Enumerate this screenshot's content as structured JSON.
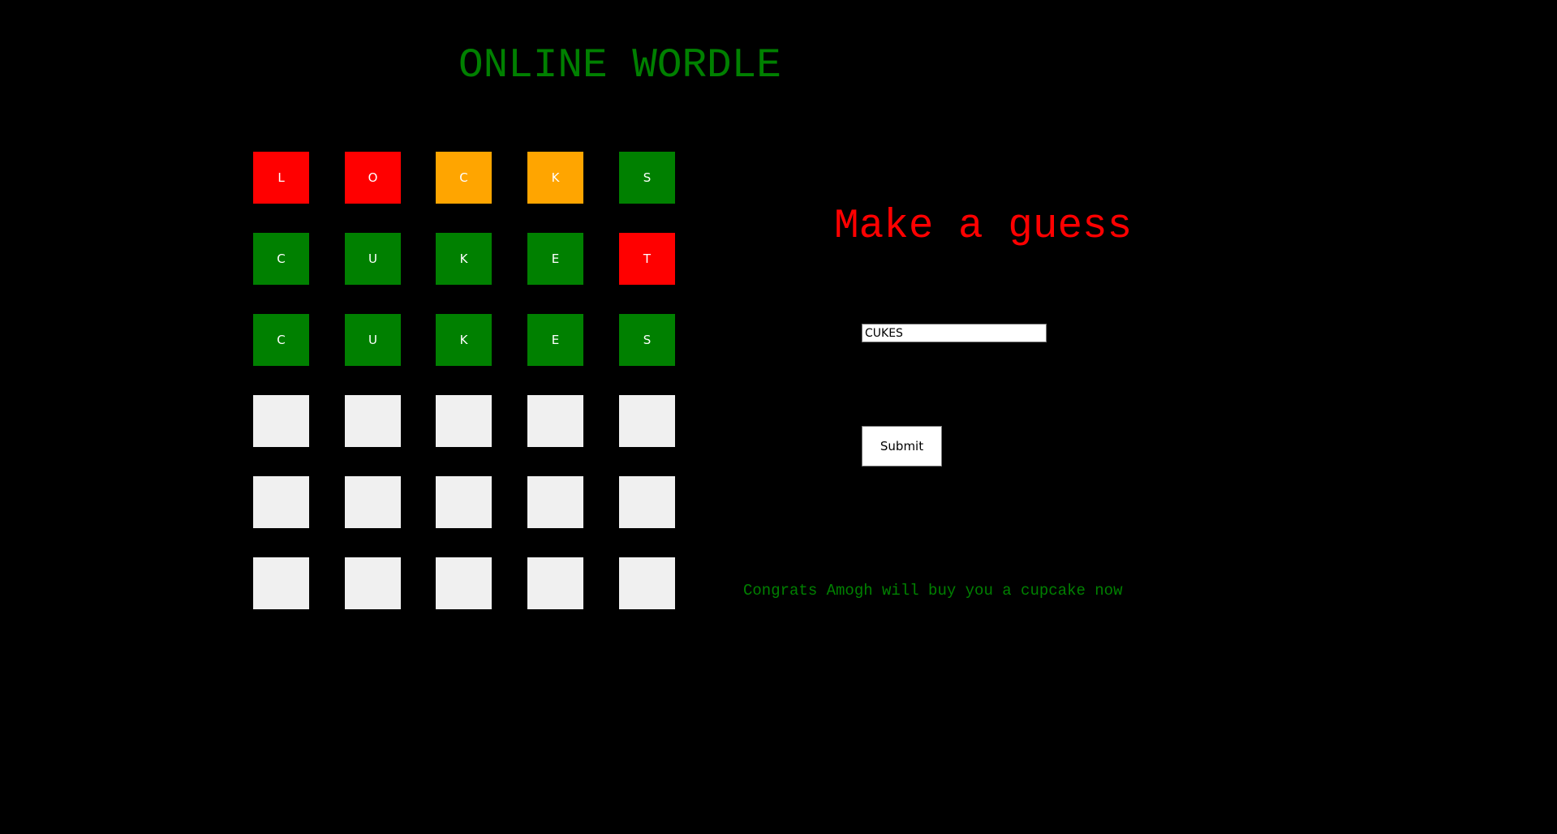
{
  "header": {
    "title": "ONLINE WORDLE"
  },
  "colors": {
    "background": "#000000",
    "title": "#008000",
    "prompt": "#ff0000",
    "message": "#008000",
    "tile_text": "#ffffff",
    "status": {
      "absent": "#ff0000",
      "present": "#ffa500",
      "correct": "#008000",
      "empty": "#f0f0f0"
    }
  },
  "board": {
    "rows": [
      [
        {
          "letter": "L",
          "status": "absent"
        },
        {
          "letter": "O",
          "status": "absent"
        },
        {
          "letter": "C",
          "status": "present"
        },
        {
          "letter": "K",
          "status": "present"
        },
        {
          "letter": "S",
          "status": "correct"
        }
      ],
      [
        {
          "letter": "C",
          "status": "correct"
        },
        {
          "letter": "U",
          "status": "correct"
        },
        {
          "letter": "K",
          "status": "correct"
        },
        {
          "letter": "E",
          "status": "correct"
        },
        {
          "letter": "T",
          "status": "absent"
        }
      ],
      [
        {
          "letter": "C",
          "status": "correct"
        },
        {
          "letter": "U",
          "status": "correct"
        },
        {
          "letter": "K",
          "status": "correct"
        },
        {
          "letter": "E",
          "status": "correct"
        },
        {
          "letter": "S",
          "status": "correct"
        }
      ],
      [
        {
          "letter": "",
          "status": "empty"
        },
        {
          "letter": "",
          "status": "empty"
        },
        {
          "letter": "",
          "status": "empty"
        },
        {
          "letter": "",
          "status": "empty"
        },
        {
          "letter": "",
          "status": "empty"
        }
      ],
      [
        {
          "letter": "",
          "status": "empty"
        },
        {
          "letter": "",
          "status": "empty"
        },
        {
          "letter": "",
          "status": "empty"
        },
        {
          "letter": "",
          "status": "empty"
        },
        {
          "letter": "",
          "status": "empty"
        }
      ],
      [
        {
          "letter": "",
          "status": "empty"
        },
        {
          "letter": "",
          "status": "empty"
        },
        {
          "letter": "",
          "status": "empty"
        },
        {
          "letter": "",
          "status": "empty"
        },
        {
          "letter": "",
          "status": "empty"
        }
      ]
    ]
  },
  "prompt": {
    "text": "Make a guess"
  },
  "guess": {
    "value": "CUKES"
  },
  "submit": {
    "label": "Submit"
  },
  "message": {
    "text": "Congrats Amogh will buy you a cupcake now"
  }
}
